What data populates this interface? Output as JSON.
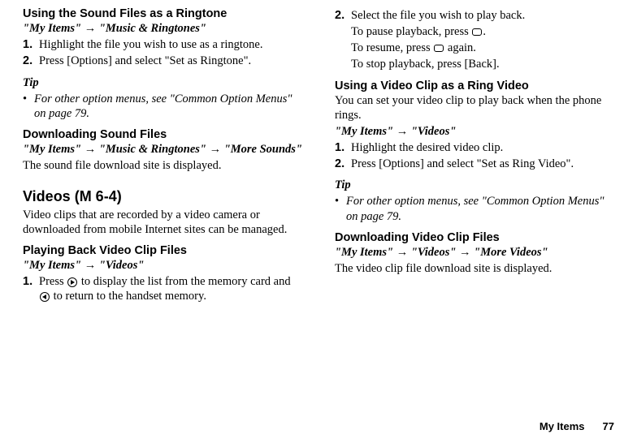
{
  "left": {
    "ringtone_head": "Using the Sound Files as a Ringtone",
    "ringtone_path": "\"My Items\" → \"Music & Ringtones\"",
    "ringtone_step1_num": "1.",
    "ringtone_step1": "Highlight the file you wish to use as a ringtone.",
    "ringtone_step2_num": "2.",
    "ringtone_step2": "Press [Options] and select \"Set as Ringtone\".",
    "tip_label1": "Tip",
    "tip_bullet1_dot": "•",
    "tip_bullet1": "For other option menus, see \"Common Option Menus\" on page 79.",
    "dl_sound_head": "Downloading Sound Files",
    "dl_sound_path": "\"My Items\" → \"Music & Ringtones\" → \"More Sounds\"",
    "dl_sound_text": "The sound file download site is displayed.",
    "videos_head": "Videos (M 6-4)",
    "videos_intro": "Video clips that are recorded by a video camera or downloaded from mobile Internet sites can be managed.",
    "playback_head": "Playing Back Video Clip Files",
    "playback_path": "\"My Items\" → \"Videos\"",
    "playback_step1_num": "1.",
    "playback_step1a": "Press ",
    "playback_step1b": " to display the list from the memory card and ",
    "playback_step1c": " to return to the handset memory."
  },
  "right": {
    "step2_num": "2.",
    "step2": "Select the file you wish to play back.",
    "pause_a": "To pause playback, press ",
    "pause_b": ".",
    "resume_a": "To resume, press ",
    "resume_b": " again.",
    "stop": "To stop playback, press [Back].",
    "ringvideo_head": "Using a Video Clip as a Ring Video",
    "ringvideo_text": "You can set your video clip to play back when the phone rings.",
    "ringvideo_path": "\"My Items\" → \"Videos\"",
    "ringvideo_step1_num": "1.",
    "ringvideo_step1": "Highlight the desired video clip.",
    "ringvideo_step2_num": "2.",
    "ringvideo_step2": "Press [Options] and select \"Set as Ring Video\".",
    "tip_label2": "Tip",
    "tip_bullet2_dot": "•",
    "tip_bullet2": "For other option menus, see \"Common Option Menus\" on page 79.",
    "dl_video_head": "Downloading Video Clip Files",
    "dl_video_path": "\"My Items\" → \"Videos\" → \"More Videos\"",
    "dl_video_text": "The video clip file download site is displayed."
  },
  "footer": {
    "label": "My Items",
    "page": "77"
  }
}
